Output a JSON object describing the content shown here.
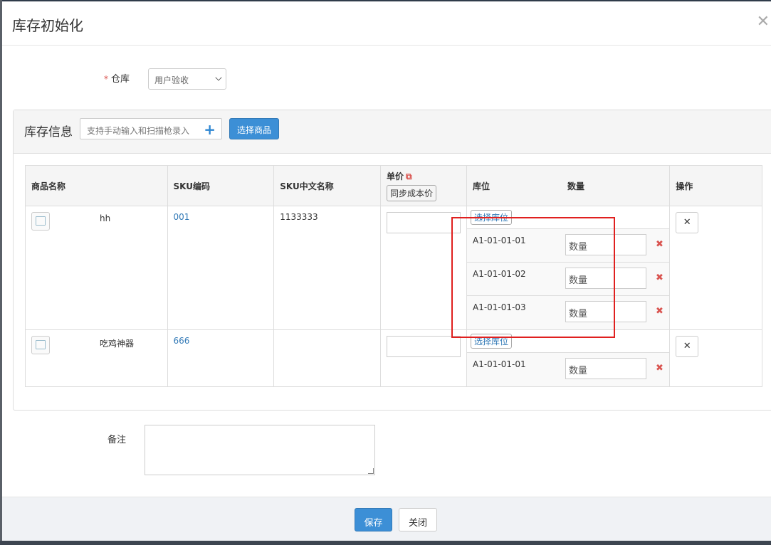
{
  "modal": {
    "title": "库存初始化",
    "close_icon": "close-icon"
  },
  "form": {
    "warehouse_label": "仓库",
    "required_mark": "*",
    "warehouse_value": "用户验收"
  },
  "panel": {
    "title": "库存信息",
    "scan_placeholder": "支持手动输入和扫描枪录入",
    "select_goods_label": "选择商品"
  },
  "table": {
    "headers": {
      "name": "商品名称",
      "sku": "SKU编码",
      "sku_cn": "SKU中文名称",
      "price": "单价",
      "sync_cost": "同步成本价",
      "location": "库位",
      "qty": "数量",
      "ops": "操作"
    },
    "rows": [
      {
        "name": "hh",
        "sku": "001",
        "sku_cn": "1133333",
        "choose_loc": "选择库位",
        "locations": [
          {
            "code": "A1-01-01-01",
            "qty_placeholder": "数量"
          },
          {
            "code": "A1-01-01-02",
            "qty_placeholder": "数量"
          },
          {
            "code": "A1-01-01-03",
            "qty_placeholder": "数量"
          }
        ]
      },
      {
        "name": "吃鸡神器",
        "sku": "666",
        "sku_cn": "",
        "choose_loc": "选择库位",
        "locations": [
          {
            "code": "A1-01-01-01",
            "qty_placeholder": "数量"
          }
        ]
      }
    ]
  },
  "remark": {
    "label": "备注"
  },
  "footer": {
    "save_label": "保存",
    "close_label": "关闭"
  },
  "colors": {
    "primary": "#3c8fd6",
    "danger": "#d9534f",
    "highlight_box": "#e0201f"
  }
}
